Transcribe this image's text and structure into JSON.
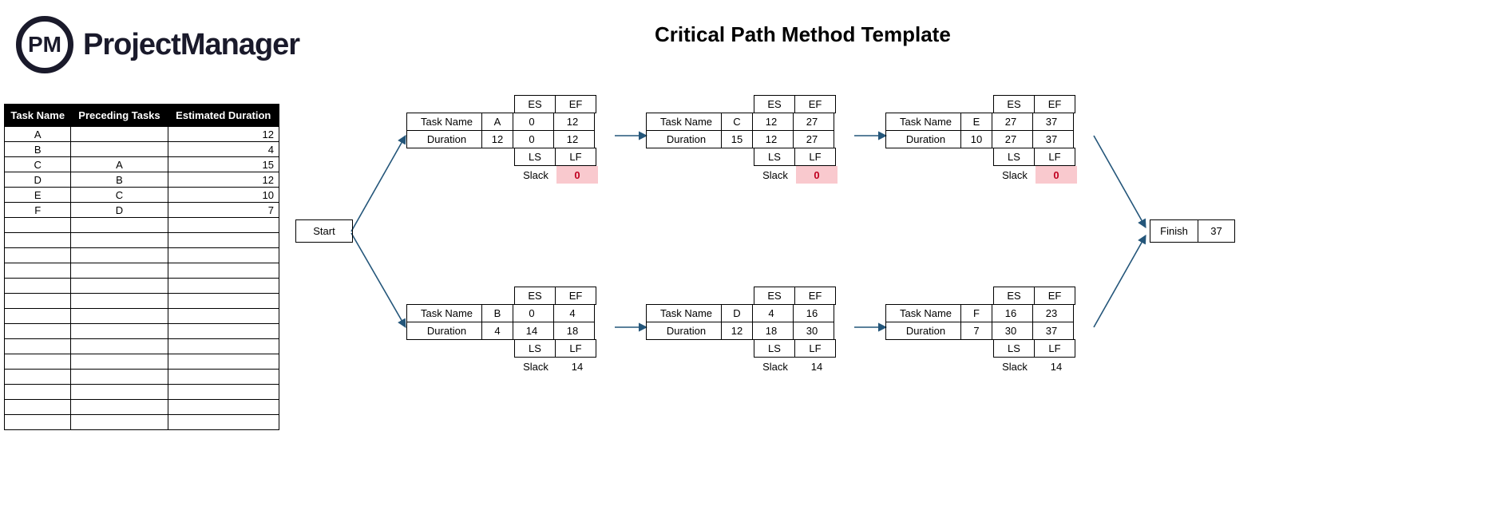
{
  "brand": "ProjectManager",
  "logo_text": "PM",
  "page_title": "Critical Path Method Template",
  "table": {
    "headers": {
      "name": "Task Name",
      "prec": "Preceding Tasks",
      "dur": "Estimated Duration"
    },
    "rows": [
      {
        "name": "A",
        "prec": "",
        "dur": "12"
      },
      {
        "name": "B",
        "prec": "",
        "dur": "4"
      },
      {
        "name": "C",
        "prec": "A",
        "dur": "15"
      },
      {
        "name": "D",
        "prec": "B",
        "dur": "12"
      },
      {
        "name": "E",
        "prec": "C",
        "dur": "10"
      },
      {
        "name": "F",
        "prec": "D",
        "dur": "7"
      }
    ],
    "empty_row_count": 14
  },
  "labels": {
    "start": "Start",
    "finish": "Finish",
    "task_name": "Task Name",
    "duration": "Duration",
    "es": "ES",
    "ef": "EF",
    "ls": "LS",
    "lf": "LF",
    "slack": "Slack"
  },
  "finish_value": "37",
  "nodes_top": [
    {
      "id": "A",
      "dur": "12",
      "es": "0",
      "ef": "12",
      "ls": "0",
      "lf": "12",
      "slack": "0",
      "critical": true
    },
    {
      "id": "C",
      "dur": "15",
      "es": "12",
      "ef": "27",
      "ls": "12",
      "lf": "27",
      "slack": "0",
      "critical": true
    },
    {
      "id": "E",
      "dur": "10",
      "es": "27",
      "ef": "37",
      "ls": "27",
      "lf": "37",
      "slack": "0",
      "critical": true
    }
  ],
  "nodes_bot": [
    {
      "id": "B",
      "dur": "4",
      "es": "0",
      "ef": "4",
      "ls": "14",
      "lf": "18",
      "slack": "14",
      "critical": false
    },
    {
      "id": "D",
      "dur": "12",
      "es": "4",
      "ef": "16",
      "ls": "18",
      "lf": "30",
      "slack": "14",
      "critical": false
    },
    {
      "id": "F",
      "dur": "7",
      "es": "16",
      "ef": "23",
      "ls": "30",
      "lf": "37",
      "slack": "14",
      "critical": false
    }
  ]
}
